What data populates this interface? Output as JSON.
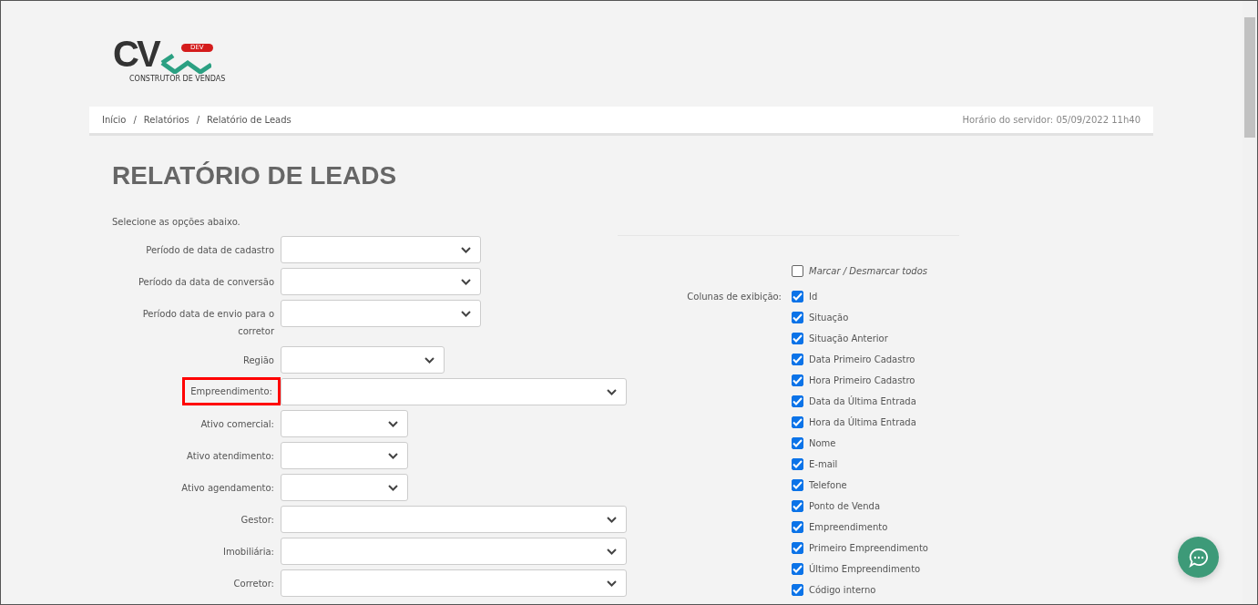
{
  "logo": {
    "letters": "CV",
    "badge": "DEV",
    "tagline": "CONSTRUTOR DE VENDAS"
  },
  "breadcrumb": [
    {
      "label": "Início"
    },
    {
      "separator": "/",
      "label": "Relatórios"
    },
    {
      "separator": "/",
      "label": "Relatório de Leads"
    }
  ],
  "server_time": "Horário do servidor: 05/09/2022 11h40",
  "title": "RELATÓRIO DE LEADS",
  "instructions": "Selecione as opções abaixo.",
  "fields": [
    {
      "label": "Período de data de cadastro",
      "kind": "medium",
      "highlighted": false
    },
    {
      "label": "Período da data de conversão",
      "kind": "medium",
      "highlighted": false
    },
    {
      "label": "Período data de envio para o corretor",
      "kind": "medium",
      "highlighted": false
    },
    {
      "label": "Região",
      "kind": "small",
      "highlighted": false
    },
    {
      "label": "Empreendimento:",
      "kind": "large",
      "highlighted": true
    },
    {
      "label": "Ativo comercial:",
      "kind": "xsmall",
      "highlighted": false
    },
    {
      "label": "Ativo atendimento:",
      "kind": "xsmall",
      "highlighted": false
    },
    {
      "label": "Ativo agendamento:",
      "kind": "xsmall",
      "highlighted": false
    },
    {
      "label": "Gestor:",
      "kind": "large",
      "highlighted": false
    },
    {
      "label": "Imobiliária:",
      "kind": "large",
      "highlighted": false
    },
    {
      "label": "Corretor:",
      "kind": "large",
      "highlighted": false
    }
  ],
  "toggle_all": {
    "label": "Marcar / Desmarcar todos",
    "checked": false
  },
  "columns_label": "Colunas de exibição:",
  "columns": [
    {
      "label": "Id",
      "checked": true
    },
    {
      "label": "Situação",
      "checked": true
    },
    {
      "label": "Situação Anterior",
      "checked": true
    },
    {
      "label": "Data Primeiro Cadastro",
      "checked": true
    },
    {
      "label": "Hora Primeiro Cadastro",
      "checked": true
    },
    {
      "label": "Data da Última Entrada",
      "checked": true
    },
    {
      "label": "Hora da Última Entrada",
      "checked": true
    },
    {
      "label": "Nome",
      "checked": true
    },
    {
      "label": "E-mail",
      "checked": true
    },
    {
      "label": "Telefone",
      "checked": true
    },
    {
      "label": "Ponto de Venda",
      "checked": true
    },
    {
      "label": "Empreendimento",
      "checked": true
    },
    {
      "label": "Primeiro Empreendimento",
      "checked": true
    },
    {
      "label": "Último Empreendimento",
      "checked": true
    },
    {
      "label": "Código interno",
      "checked": true
    }
  ]
}
